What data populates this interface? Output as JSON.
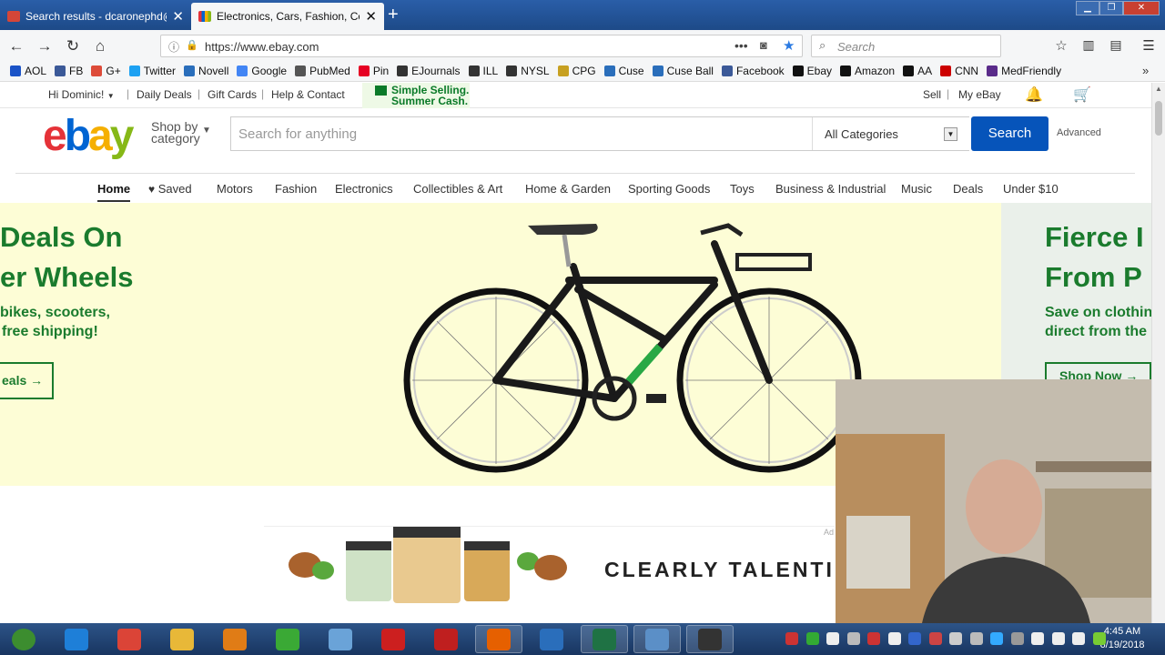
{
  "browser": {
    "tabs": [
      {
        "title": "Search results - dcaronephd@",
        "active": false,
        "favicon": "gmail-icon"
      },
      {
        "title": "Electronics, Cars, Fashion, Colle",
        "active": true,
        "favicon": "ebay-favicon"
      }
    ],
    "url": "https://www.ebay.com",
    "search_placeholder": "Search"
  },
  "bookmarks": [
    {
      "label": "AOL",
      "color": "#1a53c7"
    },
    {
      "label": "FB",
      "color": "#3b5998"
    },
    {
      "label": "G+",
      "color": "#dd4b39"
    },
    {
      "label": "Twitter",
      "color": "#1da1f2"
    },
    {
      "label": "Novell",
      "color": "#2a6ebb"
    },
    {
      "label": "Google",
      "color": "#4285f4"
    },
    {
      "label": "PubMed",
      "color": "#555555"
    },
    {
      "label": "Pin",
      "color": "#e60023"
    },
    {
      "label": "EJournals",
      "color": "#333333"
    },
    {
      "label": "ILL",
      "color": "#333333"
    },
    {
      "label": "NYSL",
      "color": "#333333"
    },
    {
      "label": "CPG",
      "color": "#c7a021"
    },
    {
      "label": "Cuse",
      "color": "#2a6ebb"
    },
    {
      "label": "Cuse Ball",
      "color": "#2a6ebb"
    },
    {
      "label": "Facebook",
      "color": "#3b5998"
    },
    {
      "label": "Ebay",
      "color": "#111111"
    },
    {
      "label": "Amazon",
      "color": "#111111"
    },
    {
      "label": "AA",
      "color": "#111111"
    },
    {
      "label": "CNN",
      "color": "#cc0000"
    },
    {
      "label": "MedFriendly",
      "color": "#5a2b8a"
    }
  ],
  "ebay": {
    "top_links": {
      "greeting": "Hi Dominic!",
      "daily_deals": "Daily Deals",
      "gift_cards": "Gift Cards",
      "help": "Help & Contact",
      "promo_line1": "Simple Selling.",
      "promo_line2": "Summer Cash.",
      "sell": "Sell",
      "my_ebay": "My eBay"
    },
    "logo": [
      "e",
      "b",
      "a",
      "y"
    ],
    "shop_by_line1": "Shop by",
    "shop_by_line2": "category",
    "search_placeholder": "Search for anything",
    "category_select": "All Categories",
    "search_button": "Search",
    "advanced": "Advanced",
    "categories": [
      "Home",
      "Saved",
      "Motors",
      "Fashion",
      "Electronics",
      "Collectibles & Art",
      "Home & Garden",
      "Sporting Goods",
      "Toys",
      "Business & Industrial",
      "Music",
      "Deals",
      "Under $10"
    ],
    "banner": {
      "headline1": "Deals On",
      "headline2": "er Wheels",
      "sub1": "bikes, scooters,",
      "sub2": "free shipping!",
      "button": "eals",
      "arrow": "→"
    },
    "banner_right": {
      "headline1": "Fierce I",
      "headline2": "From P",
      "sub1": "Save on clothin",
      "sub2": "direct from the",
      "button": "Shop Now →"
    },
    "ad": {
      "text": "CLEARLY TALENTI",
      "label": "Ad"
    }
  },
  "taskbar": {
    "time": "4:45 AM",
    "date": "6/19/2018",
    "apps": [
      {
        "name": "start-icon",
        "color": "#3c8d2f"
      },
      {
        "name": "ie-icon",
        "color": "#1e7fd8"
      },
      {
        "name": "chrome-icon",
        "color": "#db4437"
      },
      {
        "name": "explorer-icon",
        "color": "#e8b838"
      },
      {
        "name": "media-icon",
        "color": "#e07c16"
      },
      {
        "name": "camtasia-icon",
        "color": "#3aa935"
      },
      {
        "name": "app-icon",
        "color": "#6aa3d8"
      },
      {
        "name": "acrobat-icon",
        "color": "#cc1f1f"
      },
      {
        "name": "filezilla-icon",
        "color": "#bf1f1f"
      },
      {
        "name": "firefox-icon",
        "color": "#e66000"
      },
      {
        "name": "network-icon",
        "color": "#2a6ebb"
      },
      {
        "name": "excel-icon",
        "color": "#1f7244"
      },
      {
        "name": "outlook-icon",
        "color": "#5b8fc7"
      },
      {
        "name": "obs-icon",
        "color": "#333333"
      }
    ]
  }
}
